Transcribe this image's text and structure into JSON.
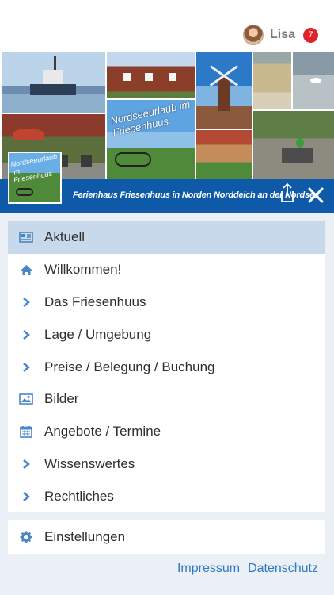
{
  "user": {
    "name": "Lisa",
    "notification_count": "7"
  },
  "header": {
    "banner_text": "Nordseeurlaub im Friesenhuus",
    "site_title": "Ferienhaus Friesenhuus in Norden Norddeich an der Nordsee"
  },
  "menu": {
    "items": [
      {
        "label": "Aktuell",
        "icon": "newspaper-icon"
      },
      {
        "label": "Willkommen!",
        "icon": "home-icon"
      },
      {
        "label": "Das Friesenhuus",
        "icon": "chevron-right-icon"
      },
      {
        "label": "Lage / Umgebung",
        "icon": "chevron-right-icon"
      },
      {
        "label": "Preise / Belegung / Buchung",
        "icon": "chevron-right-icon"
      },
      {
        "label": "Bilder",
        "icon": "image-icon"
      },
      {
        "label": "Angebote / Termine",
        "icon": "calendar-icon"
      },
      {
        "label": "Wissenswertes",
        "icon": "chevron-right-icon"
      },
      {
        "label": "Rechtliches",
        "icon": "chevron-right-icon"
      }
    ],
    "active_index": 0
  },
  "settings": {
    "label": "Einstellungen",
    "icon": "gear-icon"
  },
  "footer": {
    "impressum": "Impressum",
    "datenschutz": "Datenschutz"
  },
  "colors": {
    "primary": "#0f5aa8",
    "active_item": "#c8d9eb",
    "icon": "#4a86c5",
    "badge": "#e0232b",
    "link": "#2e78c4",
    "background": "#ebf0f6"
  }
}
